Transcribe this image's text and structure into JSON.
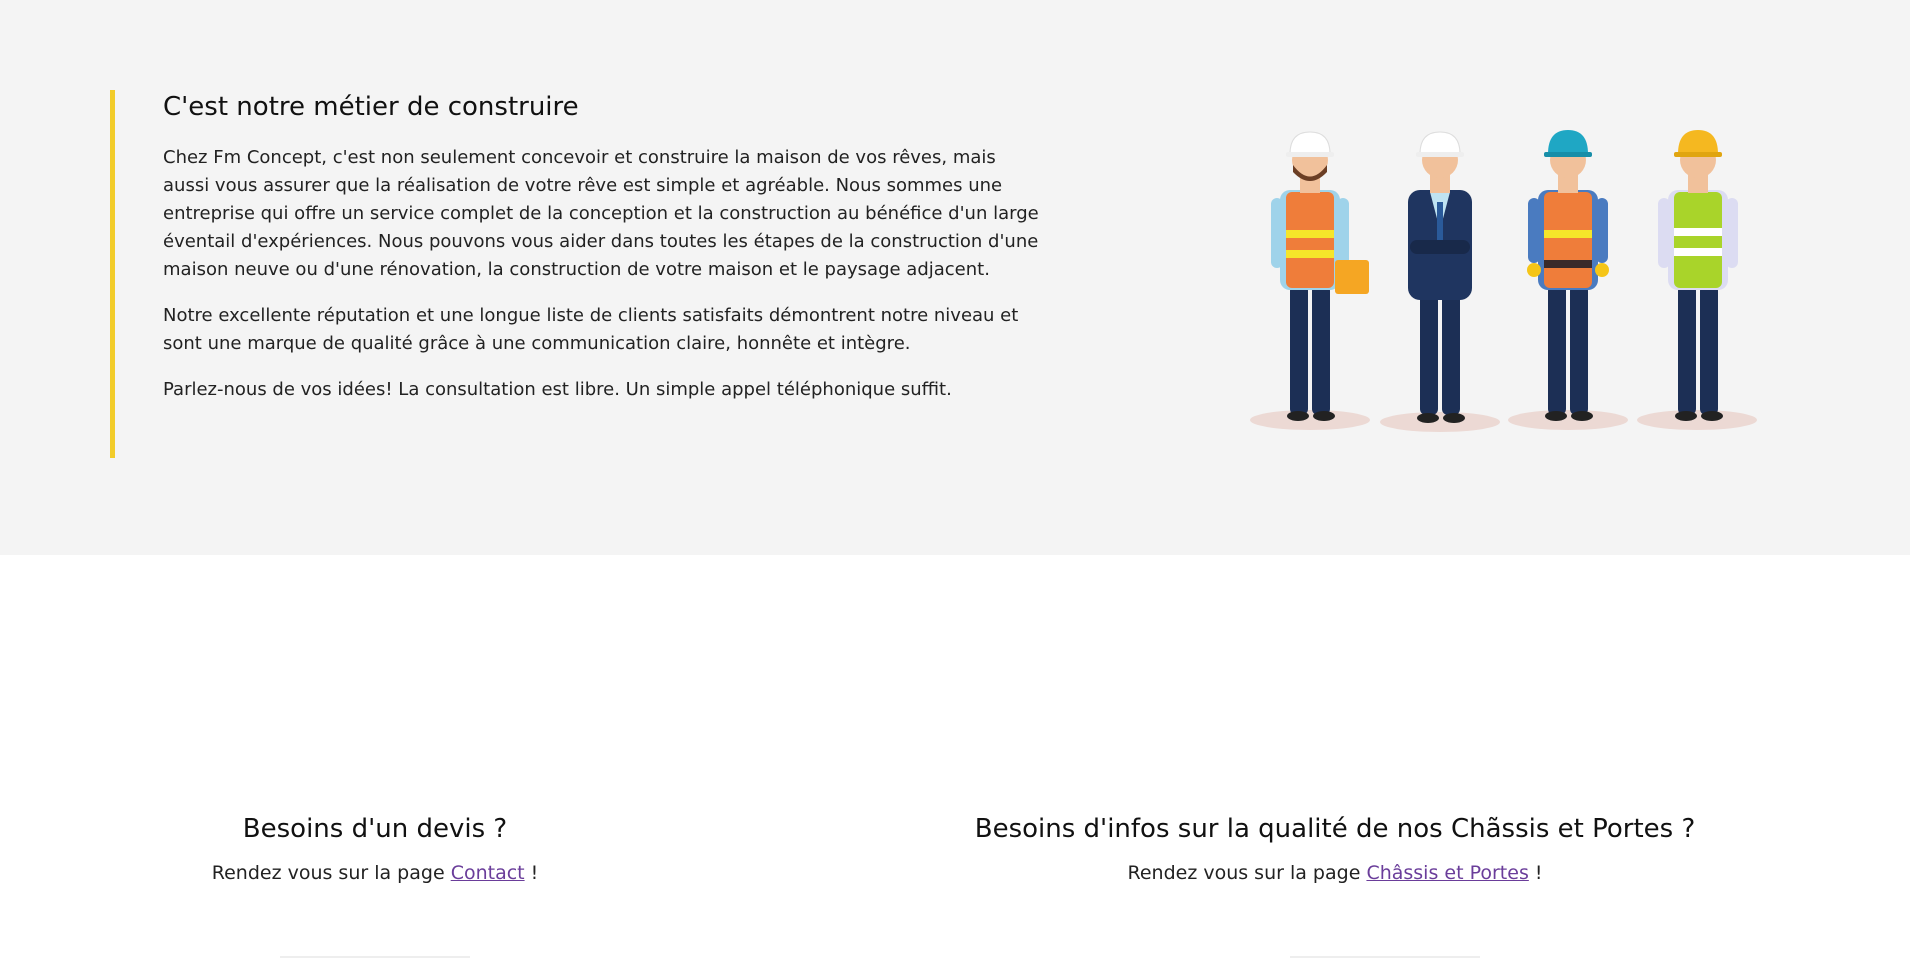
{
  "about": {
    "title": "C'est notre métier de construire",
    "paragraphs": [
      "Chez Fm Concept, c'est non seulement concevoir et construire la maison de vos rêves, mais aussi vous assurer que la réalisation de votre rêve est simple et agréable. Nous sommes une entreprise qui offre un service complet de la conception et la construction au bénéfice d'un large éventail d'expériences. Nous pouvons vous aider dans toutes les étapes de la construction d'une maison neuve ou d'une rénovation, la construction de votre maison et le paysage adjacent.",
      "Notre excellente réputation et une longue liste de clients satisfaits démontrent notre niveau et sont une marque de qualité grâce à une communication claire, honnête et intègre.",
      "Parlez-nous de vos idées! La consultation est libre. Un simple appel téléphonique suffit."
    ],
    "accent_color": "#f2cc2a",
    "illustration_icon": "construction-workers-illustration"
  },
  "cta_quote": {
    "title": "Besoins d'un devis ?",
    "text_before": "Rendez vous sur la page ",
    "link_label": "Contact",
    "text_after": " !"
  },
  "cta_products": {
    "title": "Besoins d'infos sur la qualité de nos Chãssis et Portes ?",
    "text_before": "Rendez vous sur la page ",
    "link_label": "Châssis et Portes",
    "text_after": " !"
  },
  "colors": {
    "section_bg": "#f4f4f4",
    "link": "#6a3d9a"
  }
}
